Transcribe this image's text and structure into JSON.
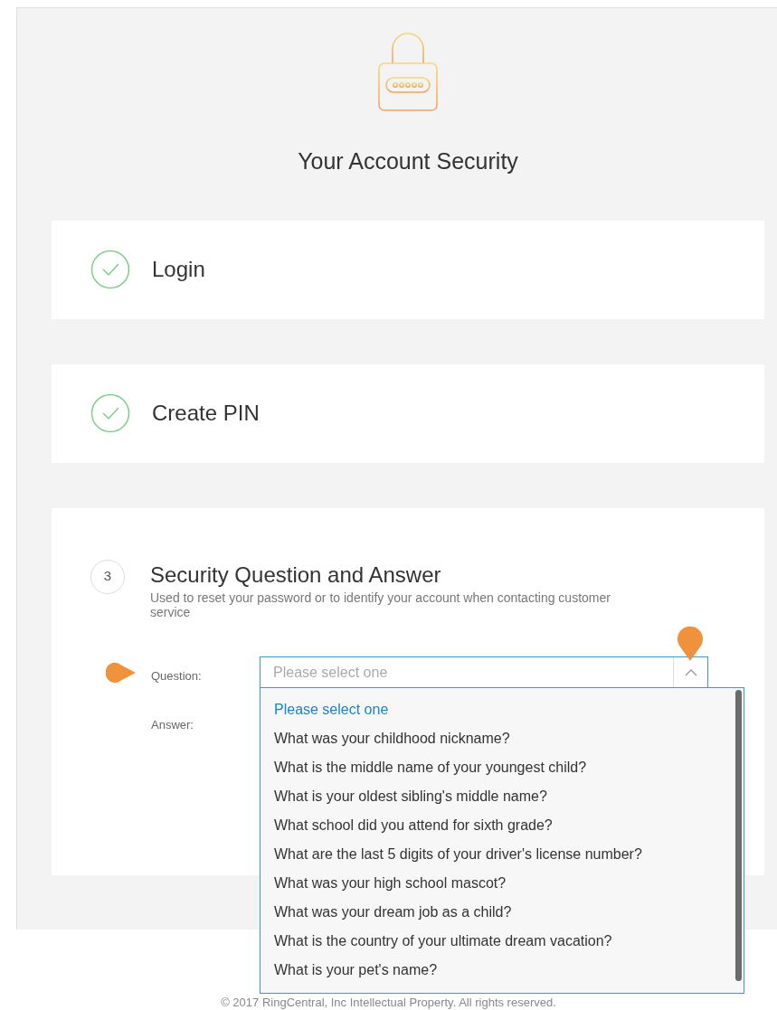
{
  "title": "Your Account Security",
  "steps": [
    {
      "kind": "done",
      "label": "Login"
    },
    {
      "kind": "done",
      "label": "Create PIN"
    },
    {
      "kind": "current",
      "number": "3",
      "label": "Security Question and Answer",
      "description": "Used to reset your password or to identify your account when contacting customer service",
      "form": {
        "question_label": "Question:",
        "answer_label": "Answer:",
        "select": {
          "placeholder": "Please select one",
          "expanded": true
        },
        "options": [
          {
            "label": "Please select one",
            "selected": true
          },
          {
            "label": "What was your childhood nickname?",
            "selected": false
          },
          {
            "label": "What is the middle name of your youngest child?",
            "selected": false
          },
          {
            "label": "What is your oldest sibling's middle name?",
            "selected": false
          },
          {
            "label": "What school did you attend for sixth grade?",
            "selected": false
          },
          {
            "label": "What are the last 5 digits of your driver's license number?",
            "selected": false
          },
          {
            "label": "What was your high school mascot?",
            "selected": false
          },
          {
            "label": "What was your dream job as a child?",
            "selected": false
          },
          {
            "label": "What is the country of your ultimate dream vacation?",
            "selected": false
          },
          {
            "label": "What is your pet's name?",
            "selected": false
          }
        ]
      }
    }
  ],
  "footer": "© 2017 RingCentral, Inc Intellectual Property. All rights reserved."
}
